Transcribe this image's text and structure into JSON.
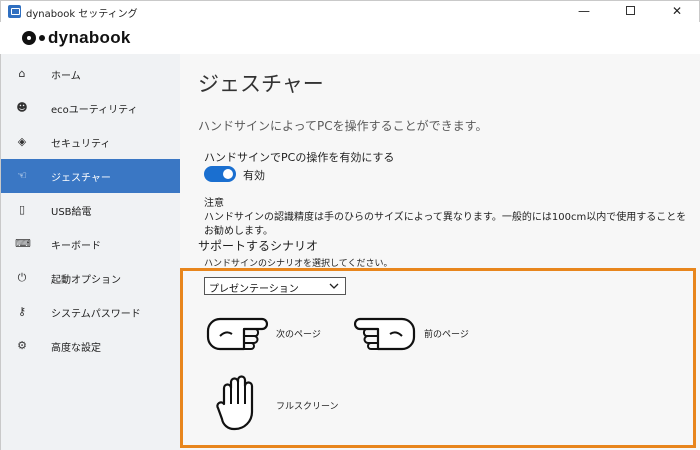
{
  "window": {
    "title": "dynabook セッティング",
    "minimize_glyph": "—",
    "close_glyph": "✕"
  },
  "brand": {
    "logo_text": "dynabook"
  },
  "sidebar": {
    "items": [
      {
        "label": "ホーム",
        "icon": "home-icon",
        "glyph": "⌂",
        "active": false
      },
      {
        "label": "ecoユーティリティ",
        "icon": "eco-leaf-icon",
        "glyph": "☻",
        "active": false
      },
      {
        "label": "セキュリティ",
        "icon": "shield-icon",
        "glyph": "◈",
        "active": false
      },
      {
        "label": "ジェスチャー",
        "icon": "hand-gesture-icon",
        "glyph": "☜",
        "active": true
      },
      {
        "label": "USB給電",
        "icon": "usb-icon",
        "glyph": "▯",
        "active": false
      },
      {
        "label": "キーボード",
        "icon": "keyboard-icon",
        "glyph": "⌨",
        "active": false
      },
      {
        "label": "起動オプション",
        "icon": "power-icon",
        "glyph": "⏻",
        "active": false
      },
      {
        "label": "システムパスワード",
        "icon": "key-icon",
        "glyph": "⚷",
        "active": false
      },
      {
        "label": "高度な設定",
        "icon": "gear-icon",
        "glyph": "⚙",
        "active": false
      }
    ]
  },
  "main": {
    "title": "ジェスチャー",
    "description": "ハンドサインによってPCを操作することができます。",
    "toggle": {
      "title": "ハンドサインでPCの操作を有効にする",
      "state_label": "有効",
      "on": true,
      "color": "#1a6fd0"
    },
    "note": {
      "title": "注意",
      "line1": "ハンドサインの認識精度は手のひらのサイズによって異なります。一般的には100cm以内で使用することを",
      "line2": "お勧めします。"
    },
    "scenario": {
      "title": "サポートするシナリオ",
      "description": "ハンドサインのシナリオを選択してください。",
      "selected": "プレゼンテーション",
      "highlight_color": "#e8861d"
    },
    "gestures": [
      {
        "label": "次のページ",
        "icon": "hand-point-right-icon"
      },
      {
        "label": "前のページ",
        "icon": "hand-point-left-icon"
      },
      {
        "label": "フルスクリーン",
        "icon": "hand-open-palm-icon"
      }
    ]
  },
  "colors": {
    "accent": "#3a77c4",
    "sidebar_bg": "#f0f2f4",
    "content_bg": "#f7f7f7"
  }
}
